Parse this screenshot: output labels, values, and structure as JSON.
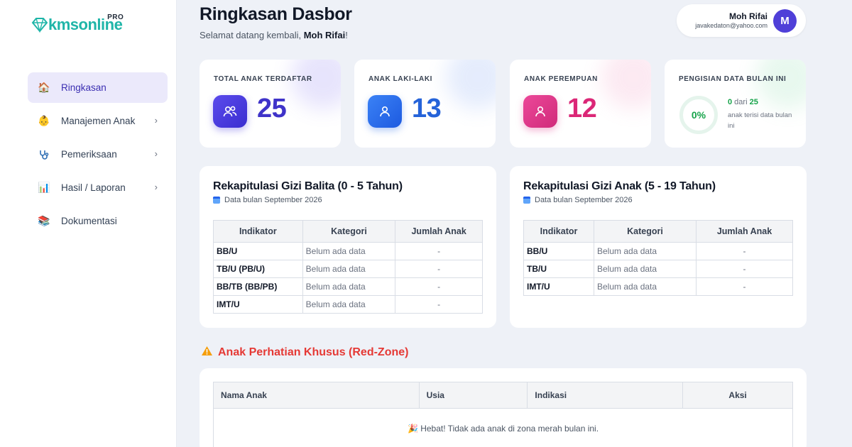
{
  "logo": {
    "text": "kmsonline",
    "pro": "PRO"
  },
  "sidebar": {
    "items": [
      {
        "label": "Ringkasan",
        "icon": "house-icon",
        "active": true
      },
      {
        "label": "Manajemen Anak",
        "icon": "baby-icon",
        "chevron": "›"
      },
      {
        "label": "Pemeriksaan",
        "icon": "stethoscope-icon",
        "chevron": "›"
      },
      {
        "label": "Hasil / Laporan",
        "icon": "bar-chart-icon",
        "chevron": "›"
      },
      {
        "label": "Dokumentasi",
        "icon": "books-icon"
      }
    ]
  },
  "header": {
    "title": "Ringkasan Dasbor",
    "subtitle_prefix": "Selamat datang kembali, ",
    "subtitle_name": "Moh Rifai",
    "subtitle_suffix": "!"
  },
  "user": {
    "name": "Moh Rifai",
    "email": "javakedaton@yahoo.com",
    "initial": "M"
  },
  "stats": [
    {
      "label": "TOTAL ANAK TERDAFTAR",
      "value": "25",
      "color": "#4a3de0"
    },
    {
      "label": "ANAK LAKI-LAKI",
      "value": "13",
      "color": "#2b6de8"
    },
    {
      "label": "ANAK PEREMPUAN",
      "value": "12",
      "color": "#e0368a"
    }
  ],
  "fill": {
    "label": "PENGISIAN DATA BULAN INI",
    "percent": "0%",
    "filled": "0",
    "of": " dari ",
    "total": "25",
    "desc": "anak terisi data bulan ini"
  },
  "recap_balita": {
    "title": "Rekapitulasi Gizi Balita (0 - 5 Tahun)",
    "subtitle": "Data bulan September 2026",
    "columns": [
      "Indikator",
      "Kategori",
      "Jumlah Anak"
    ],
    "rows": [
      {
        "ind": "BB/U",
        "cat": "Belum ada data",
        "num": "-"
      },
      {
        "ind": "TB/U (PB/U)",
        "cat": "Belum ada data",
        "num": "-"
      },
      {
        "ind": "BB/TB (BB/PB)",
        "cat": "Belum ada data",
        "num": "-"
      },
      {
        "ind": "IMT/U",
        "cat": "Belum ada data",
        "num": "-"
      }
    ]
  },
  "recap_anak": {
    "title": "Rekapitulasi Gizi Anak (5 - 19 Tahun)",
    "subtitle": "Data bulan September 2026",
    "columns": [
      "Indikator",
      "Kategori",
      "Jumlah Anak"
    ],
    "rows": [
      {
        "ind": "BB/U",
        "cat": "Belum ada data",
        "num": "-"
      },
      {
        "ind": "TB/U",
        "cat": "Belum ada data",
        "num": "-"
      },
      {
        "ind": "IMT/U",
        "cat": "Belum ada data",
        "num": "-"
      }
    ]
  },
  "redzone": {
    "title": "Anak Perhatian Khusus (Red-Zone)",
    "columns": [
      "Nama Anak",
      "Usia",
      "Indikasi",
      "Aksi"
    ],
    "empty": "🎉 Hebat! Tidak ada anak di zona merah bulan ini."
  }
}
